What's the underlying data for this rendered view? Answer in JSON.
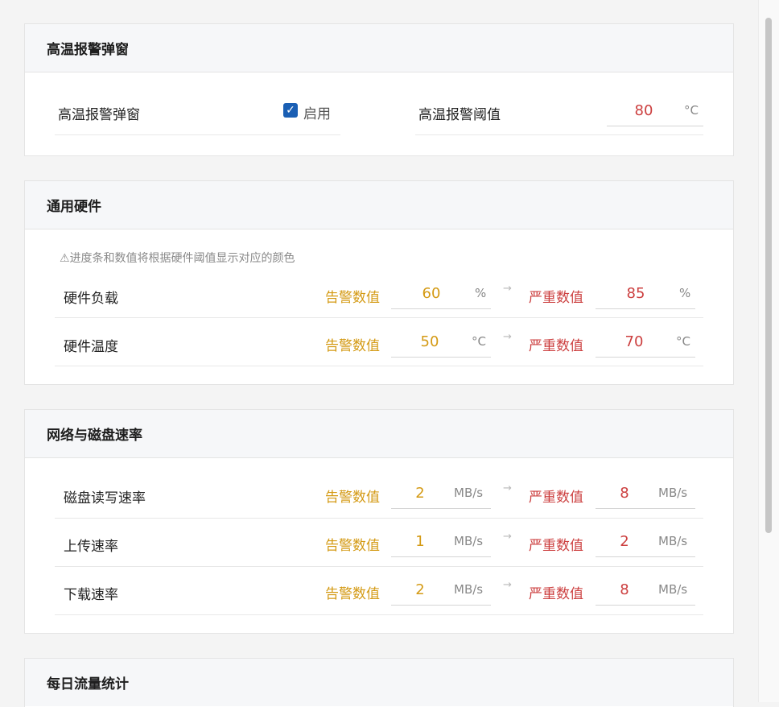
{
  "sections": {
    "high_temp": {
      "title": "高温报警弹窗",
      "popup_label": "高温报警弹窗",
      "enable_label": "启用",
      "enabled": true,
      "threshold_label": "高温报警阈值",
      "threshold_value": "80",
      "threshold_unit": "°C"
    },
    "hardware": {
      "title": "通用硬件",
      "hint": "进度条和数值将根据硬件阈值显示对应的颜色",
      "rows": [
        {
          "label": "硬件负载",
          "warn_label": "告警数值",
          "warn_value": "60",
          "warn_unit": "%",
          "crit_label": "严重数值",
          "crit_value": "85",
          "crit_unit": "%"
        },
        {
          "label": "硬件温度",
          "warn_label": "告警数值",
          "warn_value": "50",
          "warn_unit": "°C",
          "crit_label": "严重数值",
          "crit_value": "70",
          "crit_unit": "°C"
        }
      ]
    },
    "network": {
      "title": "网络与磁盘速率",
      "rows": [
        {
          "label": "磁盘读写速率",
          "warn_label": "告警数值",
          "warn_value": "2",
          "warn_unit": "MB/s",
          "crit_label": "严重数值",
          "crit_value": "8",
          "crit_unit": "MB/s"
        },
        {
          "label": "上传速率",
          "warn_label": "告警数值",
          "warn_value": "1",
          "warn_unit": "MB/s",
          "crit_label": "严重数值",
          "crit_value": "2",
          "crit_unit": "MB/s"
        },
        {
          "label": "下载速率",
          "warn_label": "告警数值",
          "warn_value": "2",
          "warn_unit": "MB/s",
          "crit_label": "严重数值",
          "crit_value": "8",
          "crit_unit": "MB/s"
        }
      ]
    },
    "daily_traffic": {
      "title": "每日流量统计"
    }
  },
  "icons": {
    "check": "check-icon",
    "warning": "warning-triangle-icon",
    "arrow": "arrow-right-icon"
  },
  "colors": {
    "warn": "#d49a14",
    "critical": "#cc3f3f",
    "accent": "#1a5fb4"
  }
}
